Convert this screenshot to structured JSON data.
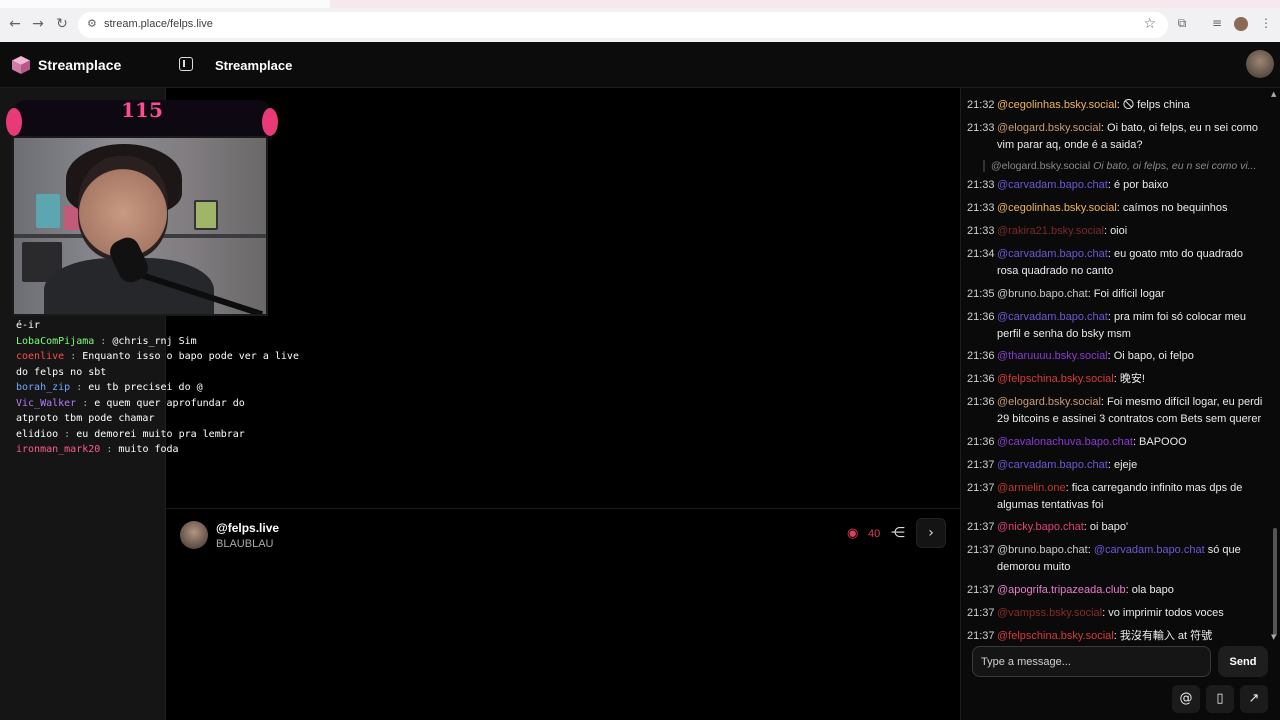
{
  "browser": {
    "url": "stream.place/felps.live"
  },
  "header": {
    "brand": "Streamplace",
    "title": "Streamplace"
  },
  "video": {
    "overlay_number": "115"
  },
  "overlay_chat": [
    {
      "name": "",
      "text": "é-ir",
      "color": "#ffffff"
    },
    {
      "name": "LobaComPijama",
      "sep": " : ",
      "text": "@chris_rnj Sim",
      "color": "#7cff7c",
      "mention_color": "#a7a7ff"
    },
    {
      "name": "coenlive",
      "sep": " : ",
      "text": "Enquanto isso o bapo pode ver a live",
      "color": "#ff4d4d"
    },
    {
      "name": "",
      "text": "do felps no sbt",
      "color": "#ffffff"
    },
    {
      "name": "borah_zip",
      "sep": " : ",
      "text": "eu tb precisei do @",
      "color": "#6ea8ff"
    },
    {
      "name": "Vic_Walker",
      "sep": " : ",
      "text": "e quem quer aprofundar do",
      "color": "#b07cff"
    },
    {
      "name": "",
      "text": "atproto tbm pode chamar",
      "color": "#ffffff"
    },
    {
      "name": "elidioo",
      "sep": " : ",
      "text": "eu demorei muito pra lembrar",
      "color": "#ffffff"
    },
    {
      "name": "ironman_mark20",
      "sep": " : ",
      "text": "muito foda",
      "color": "#ff5c8a"
    }
  ],
  "stream": {
    "handle": "@felps.live",
    "title": "BLAUBLAU",
    "viewers": "40"
  },
  "chat": {
    "messages": [
      {
        "time": "21:32",
        "user": "@cegolinhas.bsky.social",
        "color": "#f0b35c",
        "text": ": 🛇 felps china"
      },
      {
        "time": "21:33",
        "user": "@elogard.bsky.social",
        "color": "#c99a72",
        "text": ": Oi bato, oi felps, eu n sei como vim parar aq, onde é a saida?"
      },
      {
        "time": "21:33",
        "user": "@carvadam.bapo.chat",
        "color": "#6a5ad6",
        "text": ": é por baixo"
      },
      {
        "time": "21:33",
        "user": "@cegolinhas.bsky.social",
        "color": "#f0b35c",
        "text": ": caímos no bequinhos"
      },
      {
        "time": "21:33",
        "user": "@rakira21.bsky.social",
        "color": "#7a2a2a",
        "text": ": oioi"
      },
      {
        "time": "21:34",
        "user": "@carvadam.bapo.chat",
        "color": "#6a5ad6",
        "text": ": eu goato mto do quadrado rosa quadrado no canto"
      },
      {
        "time": "21:35",
        "user": "@bruno.bapo.chat",
        "color": "#c9c9c9",
        "text": ": Foi difícil logar"
      },
      {
        "time": "21:36",
        "user": "@carvadam.bapo.chat",
        "color": "#6a5ad6",
        "text": ": pra mim foi só colocar meu perfil e senha do bsky msm"
      },
      {
        "time": "21:36",
        "user": "@tharuuuu.bsky.social",
        "color": "#8a3ad6",
        "text": ": Oi bapo, oi felpo"
      },
      {
        "time": "21:36",
        "user": "@felpschina.bsky.social",
        "color": "#d63a3a",
        "text": ": 晚安!"
      },
      {
        "time": "21:36",
        "user": "@elogard.bsky.social",
        "color": "#c99a72",
        "text": ": Foi mesmo difícil logar, eu perdi 29 bitcoins e assinei 3 contratos com Bets sem querer"
      },
      {
        "time": "21:36",
        "user": "@cavalonachuva.bapo.chat",
        "color": "#8a3ad6",
        "text": ": BAPOOO"
      },
      {
        "time": "21:37",
        "user": "@carvadam.bapo.chat",
        "color": "#6a5ad6",
        "text": ": ejeje"
      },
      {
        "time": "21:37",
        "user": "@armelin.one",
        "color": "#c0392b",
        "text": ": fica carregando infinito mas dps de algumas tentativas foi"
      },
      {
        "time": "21:37",
        "user": "@nicky.bapo.chat",
        "color": "#e0407a",
        "text": ": oi bapo'"
      },
      {
        "time": "21:37",
        "user": "@bruno.bapo.chat",
        "color": "#c9c9c9",
        "text": ": ",
        "mention": "@carvadam.bapo.chat",
        "mention_color": "#6a5ad6",
        "text2": " só que demorou muito"
      },
      {
        "time": "21:37",
        "user": "@apogrifa.tripazeada.club",
        "color": "#e87ad0",
        "text": ": ola bapo"
      },
      {
        "time": "21:37",
        "user": "@vampss.bsky.social",
        "color": "#8a2a2a",
        "text": ": vo imprimir todos voces"
      },
      {
        "time": "21:37",
        "user": "@felpschina.bsky.social",
        "color": "#d63a3a",
        "text": ": 我沒有輸入 at 符號"
      }
    ],
    "reply_quote": {
      "user": "@elogard.bsky.social",
      "text": "Oi bato, oi felps, eu n sei como vi..."
    },
    "input_placeholder": "Type a message...",
    "send_label": "Send"
  }
}
